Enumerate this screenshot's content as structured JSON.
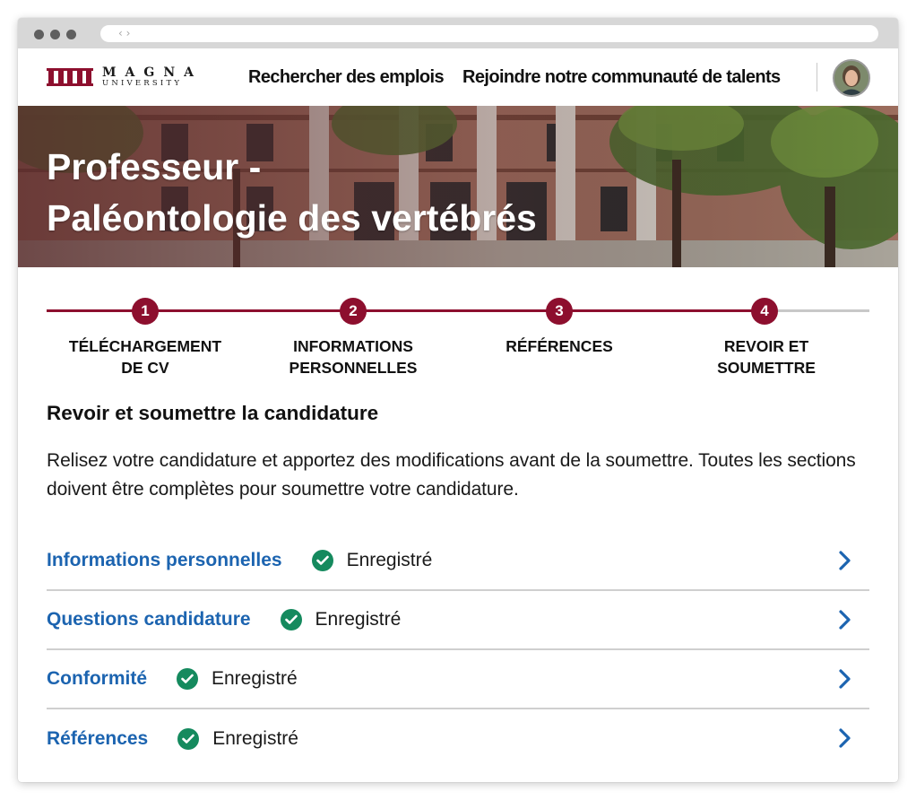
{
  "browser": {
    "url_icon": "‹ ›"
  },
  "nav": {
    "logo_line1": "MAGNA",
    "logo_line2": "UNIVERSITY",
    "links": [
      "Rechercher des emplois",
      "Rejoindre notre communauté de talents"
    ],
    "brand_color": "#8d0f2e"
  },
  "hero": {
    "title_line1": "Professeur -",
    "title_line2": "Paléontologie des vertébrés"
  },
  "stepper": {
    "steps": [
      {
        "number": "1",
        "label": "TÉLÉCHARGEMENT\nDE CV"
      },
      {
        "number": "2",
        "label": "INFORMATIONS\nPERSONNELLES"
      },
      {
        "number": "3",
        "label": "RÉFÉRENCES"
      },
      {
        "number": "4",
        "label": "REVOIR ET\nSOUMETTRE"
      }
    ],
    "current_step": 4
  },
  "review": {
    "title": "Revoir et soumettre la candidature",
    "description": "Relisez votre candidature et apportez des modifications avant de la soumettre. Toutes les sections doivent être complètes pour soumettre votre candidature.",
    "sections": [
      {
        "title": "Informations personnelles",
        "status": "Enregistré"
      },
      {
        "title": "Questions candidature",
        "status": "Enregistré"
      },
      {
        "title": "Conformité",
        "status": "Enregistré"
      },
      {
        "title": "Références",
        "status": "Enregistré"
      }
    ],
    "link_color": "#1c64b0",
    "success_color": "#158a5e"
  }
}
